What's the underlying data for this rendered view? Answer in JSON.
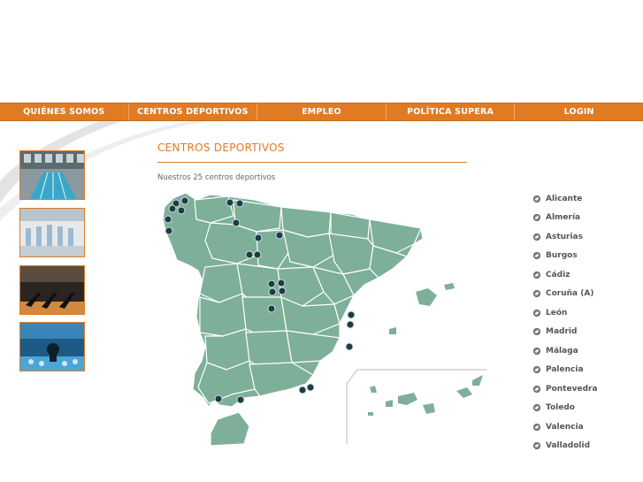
{
  "nav": {
    "items": [
      {
        "label": "QUIÉNES SOMOS"
      },
      {
        "label": "CENTROS DEPORTIVOS"
      },
      {
        "label": "EMPLEO"
      },
      {
        "label": "POLÍTICA SUPERA"
      },
      {
        "label": "LOGIN"
      }
    ]
  },
  "main": {
    "title": "CENTROS DEPORTIVOS",
    "subtitle": "Nuestros 25 centros deportivos"
  },
  "thumbnails": [
    {
      "name": "indoor-pool-photo"
    },
    {
      "name": "gym-hall-photo"
    },
    {
      "name": "treadmills-photo"
    },
    {
      "name": "spinning-class-photo"
    }
  ],
  "cities": [
    {
      "label": "Alicante"
    },
    {
      "label": "Almería"
    },
    {
      "label": "Asturias"
    },
    {
      "label": "Burgos"
    },
    {
      "label": "Cádiz"
    },
    {
      "label": "Coruña (A)"
    },
    {
      "label": "León"
    },
    {
      "label": "Madrid"
    },
    {
      "label": "Málaga"
    },
    {
      "label": "Palencia"
    },
    {
      "label": "Pontevedra"
    },
    {
      "label": "Toledo"
    },
    {
      "label": "Valencia"
    },
    {
      "label": "Valladolid"
    }
  ],
  "colors": {
    "accent": "#e07b24",
    "map_fill": "#7daf99",
    "marker": "#1f3a4a"
  }
}
